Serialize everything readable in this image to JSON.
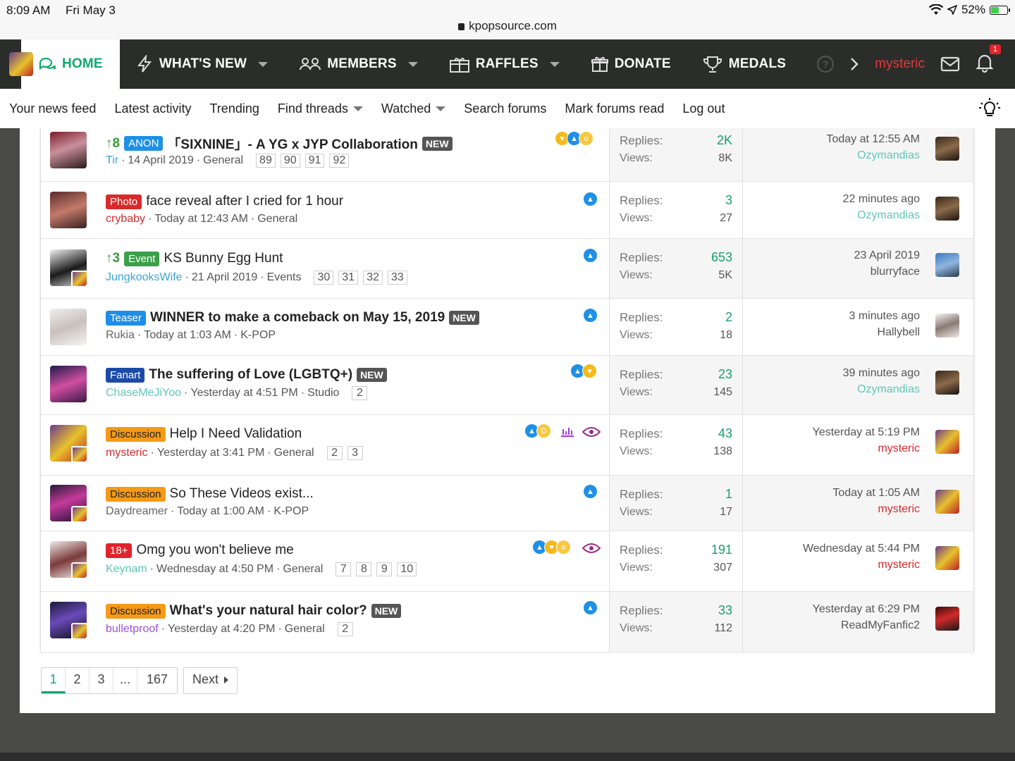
{
  "status": {
    "time": "8:09 AM",
    "date": "Fri May 3",
    "battery": "52%"
  },
  "url": "kpopsource.com",
  "nav": {
    "tabs": [
      {
        "label": "HOME"
      },
      {
        "label": "WHAT'S NEW"
      },
      {
        "label": "MEMBERS"
      },
      {
        "label": "RAFFLES"
      },
      {
        "label": "DONATE"
      },
      {
        "label": "MEDALS"
      }
    ],
    "username": "mysteric",
    "alerts_count": "1",
    "help": "?"
  },
  "subnav": {
    "items": [
      "Your news feed",
      "Latest activity",
      "Trending",
      "Find threads",
      "Watched",
      "Search forums",
      "Mark forums read",
      "Log out"
    ]
  },
  "threads": [
    {
      "upvotes": "8",
      "prefix": "ANON",
      "title": "「SIXNINE」- A YG x JYP Collaboration",
      "new": "NEW",
      "author": "Tir",
      "date": "14 April 2019",
      "forum": "General",
      "pages": [
        "89",
        "90",
        "91",
        "92"
      ],
      "replies_label": "Replies:",
      "replies": "2K",
      "views_label": "Views:",
      "views": "8K",
      "last_date": "Today at 12:55 AM",
      "last_user": "Ozymandias"
    },
    {
      "prefix": "Photo",
      "title": "face reveal after I cried for 1 hour",
      "author": "crybaby",
      "date": "Today at 12:43 AM",
      "forum": "General",
      "replies_label": "Replies:",
      "replies": "3",
      "views_label": "Views:",
      "views": "27",
      "last_date": "22 minutes ago",
      "last_user": "Ozymandias"
    },
    {
      "upvotes": "3",
      "prefix": "Event",
      "title": "KS Bunny Egg Hunt",
      "author": "JungkooksWife",
      "date": "21 April 2019",
      "forum": "Events",
      "pages": [
        "30",
        "31",
        "32",
        "33"
      ],
      "replies_label": "Replies:",
      "replies": "653",
      "views_label": "Views:",
      "views": "5K",
      "last_date": "23 April 2019",
      "last_user": "blurryface"
    },
    {
      "prefix": "Teaser",
      "title": "WINNER to make a comeback on May 15, 2019",
      "new": "NEW",
      "author": "Rukia",
      "date": "Today at 1:03 AM",
      "forum": "K-POP",
      "replies_label": "Replies:",
      "replies": "2",
      "views_label": "Views:",
      "views": "18",
      "last_date": "3 minutes ago",
      "last_user": "Hallybell"
    },
    {
      "prefix": "Fanart",
      "title": "The suffering of Love (LGBTQ+)",
      "new": "NEW",
      "author": "ChaseMeJiYoo",
      "date": "Yesterday at 4:51 PM",
      "forum": "Studio",
      "pages": [
        "2"
      ],
      "replies_label": "Replies:",
      "replies": "23",
      "views_label": "Views:",
      "views": "145",
      "last_date": "39 minutes ago",
      "last_user": "Ozymandias"
    },
    {
      "prefix": "Discussion",
      "title": "Help I Need Validation",
      "author": "mysteric",
      "date": "Yesterday at 3:41 PM",
      "forum": "General",
      "pages": [
        "2",
        "3"
      ],
      "replies_label": "Replies:",
      "replies": "43",
      "views_label": "Views:",
      "views": "138",
      "last_date": "Yesterday at 5:19 PM",
      "last_user": "mysteric"
    },
    {
      "prefix": "Discussion",
      "title": "So These Videos exist...",
      "author": "Daydreamer",
      "date": "Today at 1:00 AM",
      "forum": "K-POP",
      "replies_label": "Replies:",
      "replies": "1",
      "views_label": "Views:",
      "views": "17",
      "last_date": "Today at 1:05 AM",
      "last_user": "mysteric"
    },
    {
      "prefix": "18+",
      "title": "Omg you won't believe me",
      "author": "Keynam",
      "date": "Wednesday at 4:50 PM",
      "forum": "General",
      "pages": [
        "7",
        "8",
        "9",
        "10"
      ],
      "replies_label": "Replies:",
      "replies": "191",
      "views_label": "Views:",
      "views": "307",
      "last_date": "Wednesday at 5:44 PM",
      "last_user": "mysteric"
    },
    {
      "prefix": "Discussion",
      "title": "What's your natural hair color?",
      "new": "NEW",
      "author": "bulletproof",
      "date": "Yesterday at 4:20 PM",
      "forum": "General",
      "pages": [
        "2"
      ],
      "replies_label": "Replies:",
      "replies": "33",
      "views_label": "Views:",
      "views": "112",
      "last_date": "Yesterday at 6:29 PM",
      "last_user": "ReadMyFanfic2"
    }
  ],
  "pagination": {
    "pages": [
      "1",
      "2",
      "3",
      "...",
      "167"
    ],
    "next": "Next"
  },
  "colors": {
    "accent": "#11a86f",
    "nav_bg": "#2b2d2b",
    "replies": "#19a06a",
    "username_red": "#d9292b"
  }
}
